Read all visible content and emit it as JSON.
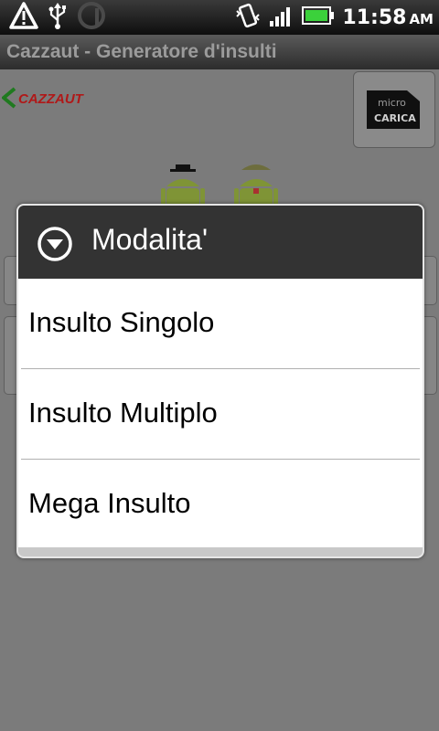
{
  "status_bar": {
    "time": "11:58",
    "ampm": "AM",
    "icons": [
      "warning-icon",
      "usb-icon",
      "sync-icon",
      "vibrate-icon",
      "signal-icon",
      "battery-icon"
    ]
  },
  "title_bar": {
    "title": "Cazzaut - Generatore d'insulti"
  },
  "content": {
    "logo_text": "CAZZAUT",
    "sd_button": {
      "line1": "micro",
      "line2": "CARICA"
    }
  },
  "dialog": {
    "title": "Modalita'",
    "options": [
      {
        "label": "Insulto Singolo"
      },
      {
        "label": "Insulto Multiplo"
      },
      {
        "label": "Mega Insulto"
      }
    ]
  },
  "colors": {
    "dialog_header": "#333333",
    "logo_red": "#cc1f1f",
    "logo_green": "#2e8b2e",
    "android_green": "#8fa53a"
  }
}
